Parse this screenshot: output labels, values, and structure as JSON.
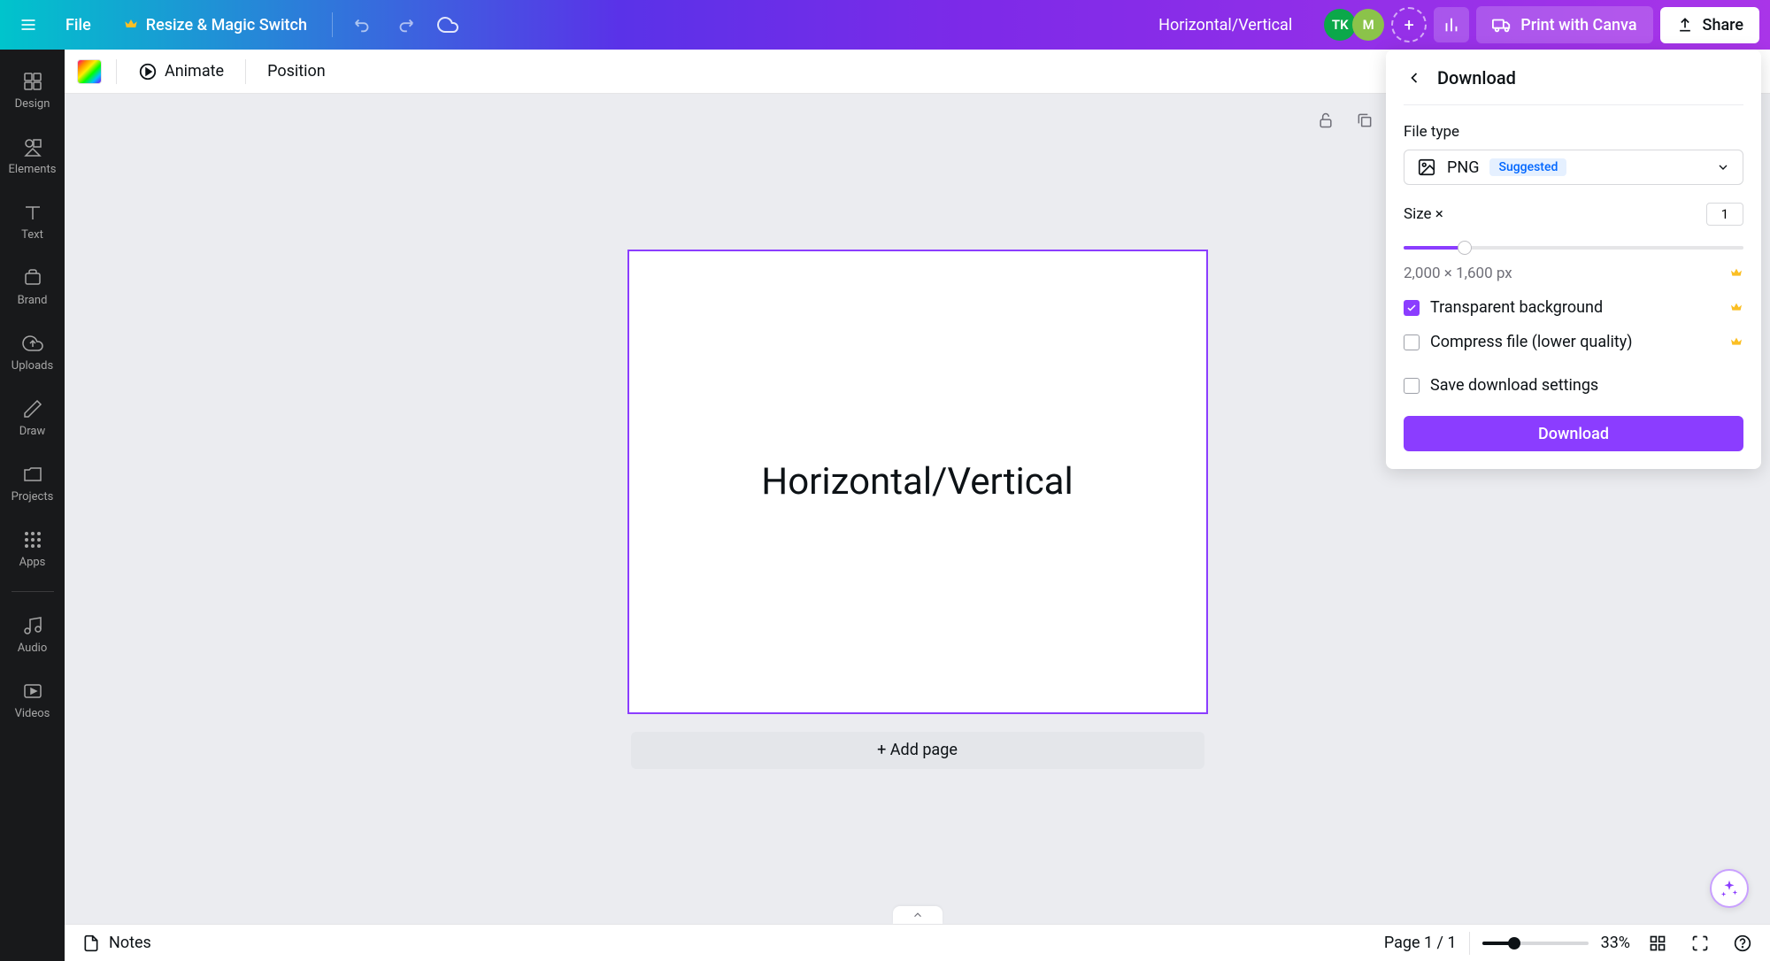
{
  "header": {
    "file_label": "File",
    "resize_label": "Resize & Magic Switch",
    "design_title": "Horizontal/Vertical",
    "avatar1_initials": "TK",
    "avatar2_initials": "M",
    "print_label": "Print with Canva",
    "share_label": "Share"
  },
  "sidebar": {
    "items": [
      {
        "label": "Design",
        "icon": "design"
      },
      {
        "label": "Elements",
        "icon": "elements"
      },
      {
        "label": "Text",
        "icon": "text"
      },
      {
        "label": "Brand",
        "icon": "brand"
      },
      {
        "label": "Uploads",
        "icon": "uploads"
      },
      {
        "label": "Draw",
        "icon": "draw"
      },
      {
        "label": "Projects",
        "icon": "projects"
      },
      {
        "label": "Apps",
        "icon": "apps"
      },
      {
        "label": "Audio",
        "icon": "audio"
      },
      {
        "label": "Videos",
        "icon": "videos"
      }
    ]
  },
  "sec_toolbar": {
    "animate_label": "Animate",
    "position_label": "Position"
  },
  "canvas": {
    "page_text": "Horizontal/Vertical",
    "add_page_label": "+ Add page"
  },
  "download_panel": {
    "title": "Download",
    "file_type_label": "File type",
    "file_type_value": "PNG",
    "suggested_badge": "Suggested",
    "size_label": "Size ×",
    "size_value": "1",
    "dimensions": "2,000 × 1,600 px",
    "transparent_label": "Transparent background",
    "compress_label": "Compress file (lower quality)",
    "save_settings_label": "Save download settings",
    "download_button": "Download",
    "transparent_checked": true,
    "compress_checked": false,
    "save_checked": false
  },
  "bottom_bar": {
    "notes_label": "Notes",
    "page_indicator": "Page 1 / 1",
    "zoom_pct": "33%"
  }
}
